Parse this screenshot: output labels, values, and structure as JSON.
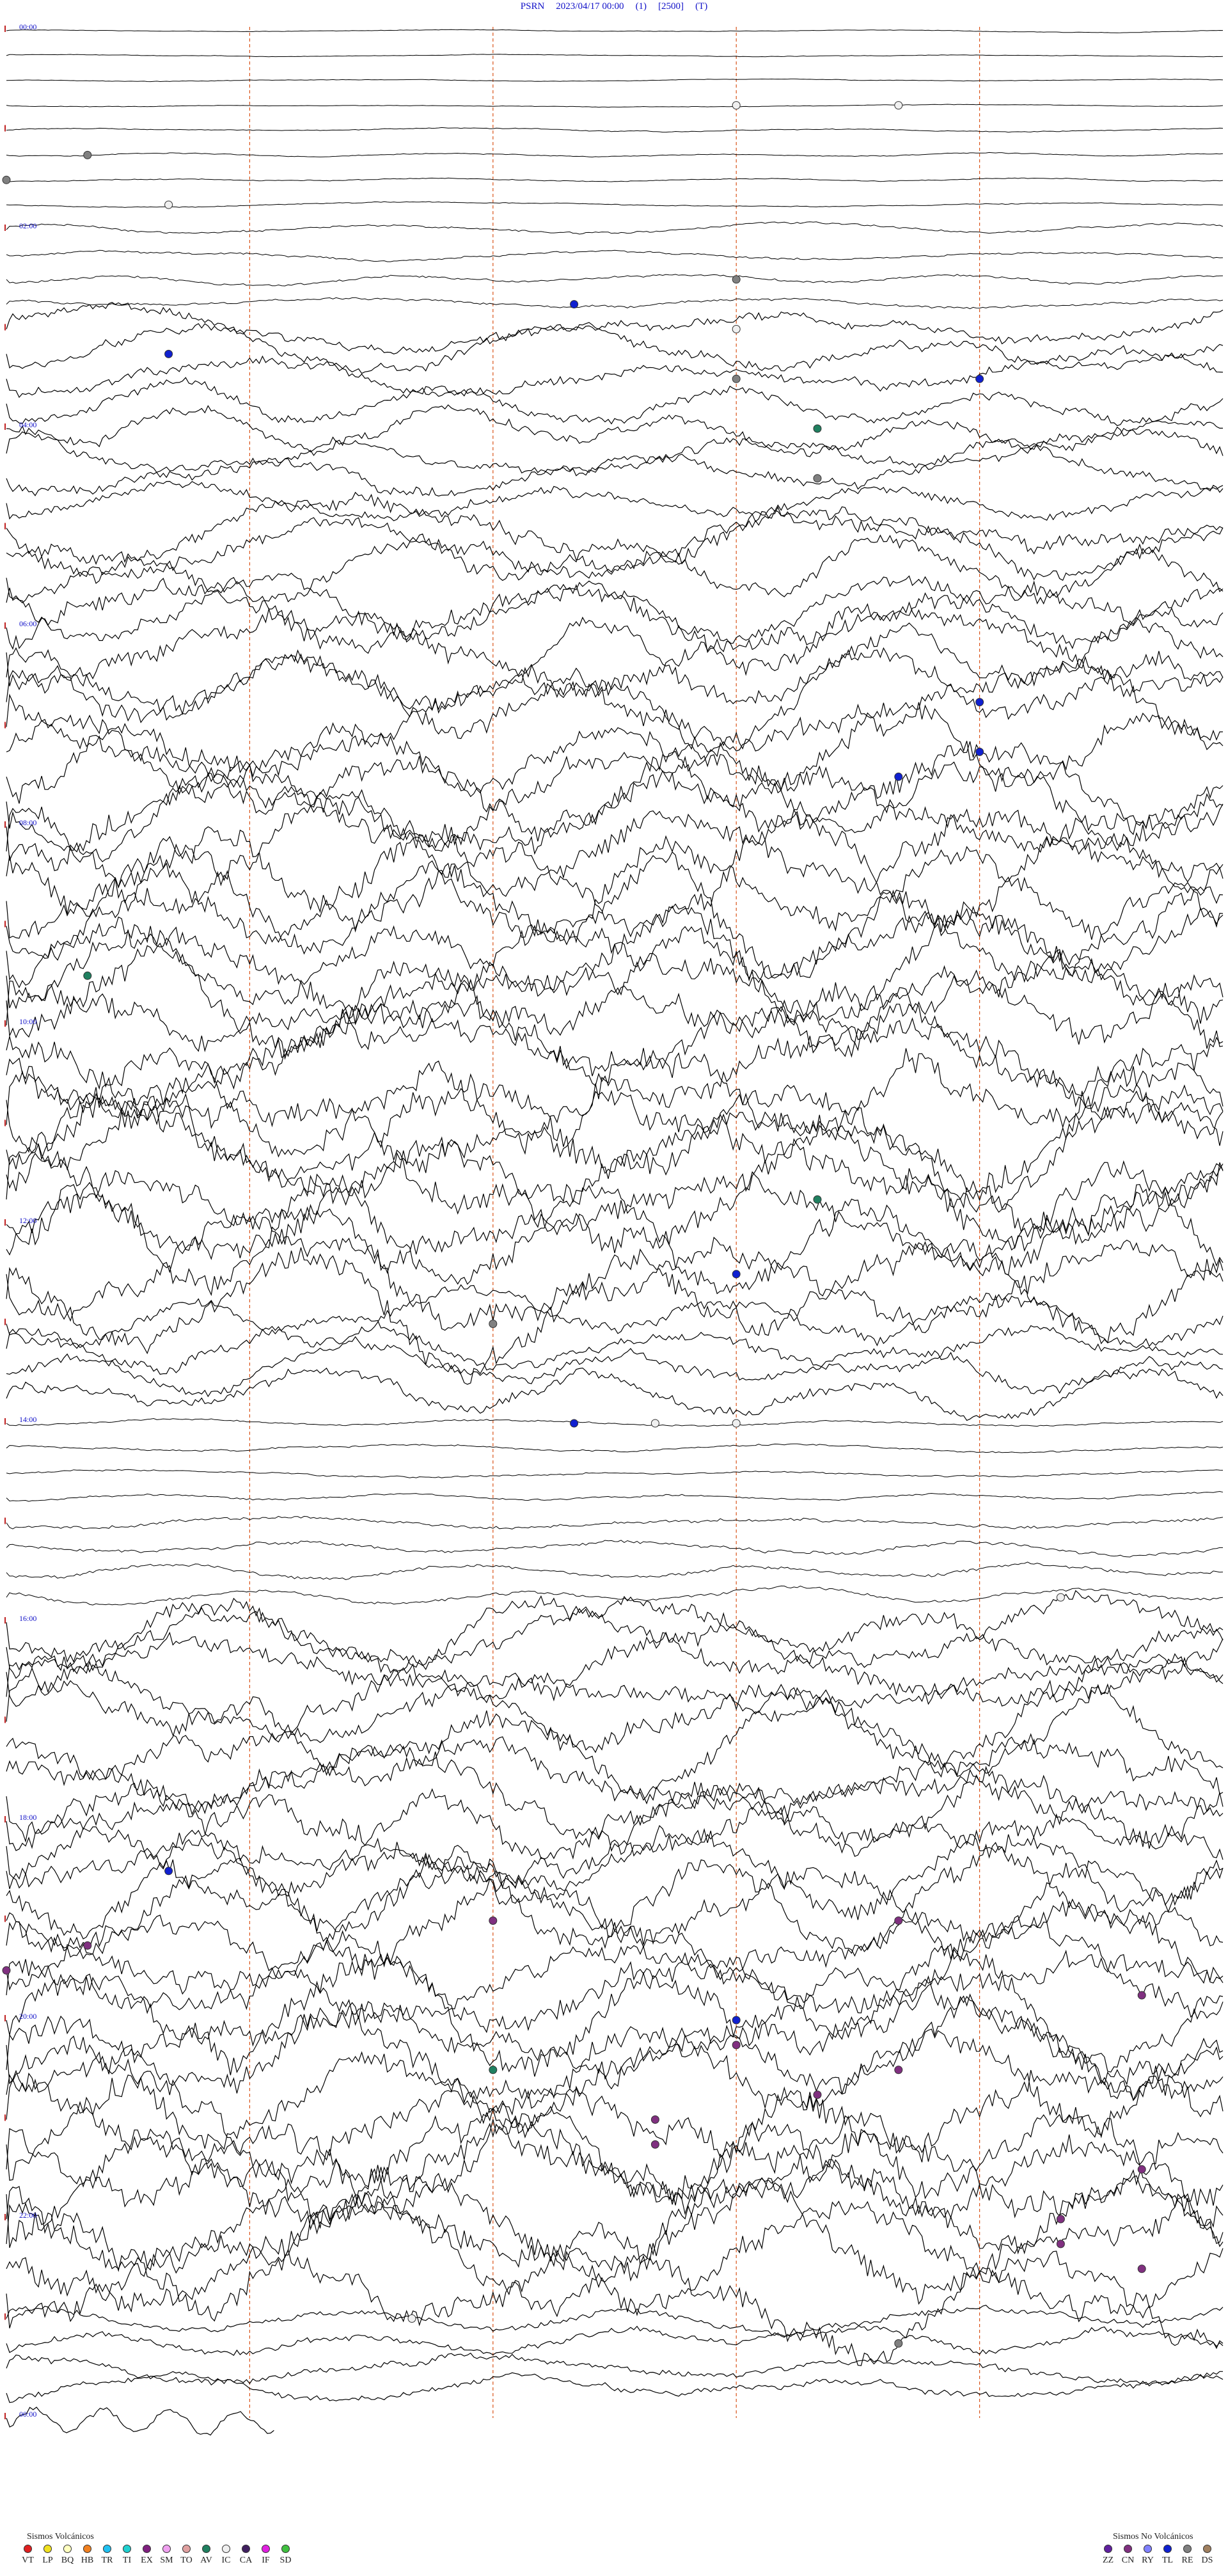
{
  "header": {
    "station": "PSRN",
    "datetime": "2023/04/17 00:00",
    "channel": "(1)",
    "scale": "[2500]",
    "flag": "(T)"
  },
  "chart_data": {
    "type": "helicorder",
    "title": "PSRN 2023/04/17 00:00 (1) [2500] (T)",
    "hour_labels": [
      "00:00",
      "",
      "02:00",
      "",
      "04:00",
      "",
      "06:00",
      "",
      "08:00",
      "",
      "10:00",
      "",
      "12:00",
      "",
      "14:00",
      "",
      "16:00",
      "",
      "18:00",
      "",
      "20:00",
      "",
      "22:00",
      "",
      "00:00"
    ],
    "line_color": "#000000",
    "minute_marker_color": "#d9541a",
    "hour_label_color": "#1010c8",
    "noise_level_by_hour": [
      0.05,
      0.08,
      0.2,
      0.9,
      0.9,
      1.4,
      1.8,
      2.0,
      2.2,
      2.2,
      2.4,
      2.5,
      2.3,
      1.0,
      0.15,
      0.3,
      1.6,
      1.9,
      2.0,
      2.1,
      2.3,
      2.5,
      2.4,
      0.6
    ],
    "events": [
      {
        "time": "00:54",
        "type": "IC"
      },
      {
        "time": "00:56",
        "type": "IC"
      },
      {
        "time": "01:16",
        "type": "RE"
      },
      {
        "time": "01:30",
        "type": "RE"
      },
      {
        "time": "01:47",
        "type": "IC"
      },
      {
        "time": "02:52",
        "type": "TL"
      },
      {
        "time": "02:39",
        "type": "RE"
      },
      {
        "time": "03:17",
        "type": "TL"
      },
      {
        "time": "03:09",
        "type": "IC"
      },
      {
        "time": "03:42",
        "type": "TL"
      },
      {
        "time": "03:39",
        "type": "RE"
      },
      {
        "time": "04:10",
        "type": "AV"
      },
      {
        "time": "04:40",
        "type": "RE"
      },
      {
        "time": "06:57",
        "type": "TL"
      },
      {
        "time": "07:27",
        "type": "TL"
      },
      {
        "time": "07:41",
        "type": "TL"
      },
      {
        "time": "09:31",
        "type": "AV"
      },
      {
        "time": "11:55",
        "type": "AV"
      },
      {
        "time": "12:39",
        "type": "TL"
      },
      {
        "time": "13:06",
        "type": "RE"
      },
      {
        "time": "14:07",
        "type": "TL"
      },
      {
        "time": "14:08",
        "type": "IC"
      },
      {
        "time": "14:09",
        "type": "IC"
      },
      {
        "time": "15:58",
        "type": "IC"
      },
      {
        "time": "18:32",
        "type": "TL"
      },
      {
        "time": "19:06",
        "type": "CN"
      },
      {
        "time": "19:11",
        "type": "CN"
      },
      {
        "time": "19:16",
        "type": "CN"
      },
      {
        "time": "19:30",
        "type": "CN"
      },
      {
        "time": "19:59",
        "type": "CN"
      },
      {
        "time": "20:09",
        "type": "TL"
      },
      {
        "time": "20:36",
        "type": "AV"
      },
      {
        "time": "20:24",
        "type": "CN"
      },
      {
        "time": "20:41",
        "type": "CN"
      },
      {
        "time": "20:55",
        "type": "CN"
      },
      {
        "time": "21:08",
        "type": "CN"
      },
      {
        "time": "21:23",
        "type": "CN"
      },
      {
        "time": "21:44",
        "type": "CN"
      },
      {
        "time": "22:13",
        "type": "CN"
      },
      {
        "time": "22:28",
        "type": "CN"
      },
      {
        "time": "22:44",
        "type": "CN"
      },
      {
        "time": "23:05",
        "type": "IC"
      },
      {
        "time": "23:26",
        "type": "RE"
      }
    ]
  },
  "legend_volcanic": {
    "title": "Sismos Volcánicos",
    "items": [
      {
        "code": "VT",
        "color": "#e02020"
      },
      {
        "code": "LP",
        "color": "#f0e020"
      },
      {
        "code": "BQ",
        "color": "#ffffc0"
      },
      {
        "code": "HB",
        "color": "#f08020"
      },
      {
        "code": "TR",
        "color": "#20c0f0"
      },
      {
        "code": "TI",
        "color": "#20d0d0"
      },
      {
        "code": "EX",
        "color": "#802080"
      },
      {
        "code": "SM",
        "color": "#f0a0f0"
      },
      {
        "code": "TO",
        "color": "#e0a0a0"
      },
      {
        "code": "AV",
        "color": "#208060"
      },
      {
        "code": "IC",
        "color": "#f0f0f0"
      },
      {
        "code": "CA",
        "color": "#402060"
      },
      {
        "code": "IF",
        "color": "#e020e0"
      },
      {
        "code": "SD",
        "color": "#40c040"
      }
    ]
  },
  "legend_nonvolcanic": {
    "title": "Sismos No Volcánicos",
    "items": [
      {
        "code": "ZZ",
        "color": "#6020a0"
      },
      {
        "code": "CN",
        "color": "#803080"
      },
      {
        "code": "RY",
        "color": "#8080ff"
      },
      {
        "code": "TL",
        "color": "#1020d0"
      },
      {
        "code": "RE",
        "color": "#808080"
      },
      {
        "code": "DS",
        "color": "#a08060"
      }
    ]
  }
}
